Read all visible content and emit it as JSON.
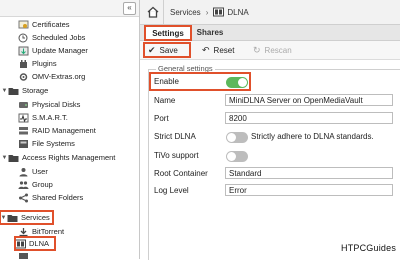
{
  "sidebar": {
    "collapse_glyph": "«",
    "items": [
      {
        "label": "Certificates",
        "icon": "certificate-icon"
      },
      {
        "label": "Scheduled Jobs",
        "icon": "clock-icon"
      },
      {
        "label": "Update Manager",
        "icon": "update-icon"
      },
      {
        "label": "Plugins",
        "icon": "plugin-icon"
      },
      {
        "label": "OMV-Extras.org",
        "icon": "extras-icon"
      },
      {
        "label": "Storage",
        "icon": "folder-icon",
        "expand": "▼"
      },
      {
        "label": "Physical Disks",
        "icon": "disk-icon"
      },
      {
        "label": "S.M.A.R.T.",
        "icon": "smart-icon"
      },
      {
        "label": "RAID Management",
        "icon": "raid-icon"
      },
      {
        "label": "File Systems",
        "icon": "filesystem-icon"
      },
      {
        "label": "Access Rights Management",
        "icon": "folder-icon",
        "expand": "▼"
      },
      {
        "label": "User",
        "icon": "user-icon"
      },
      {
        "label": "Group",
        "icon": "group-icon"
      },
      {
        "label": "Shared Folders",
        "icon": "share-icon"
      },
      {
        "label": "Services",
        "icon": "folder-icon",
        "expand": "▼"
      },
      {
        "label": "BitTorrent",
        "icon": "torrent-icon"
      },
      {
        "label": "DLNA",
        "icon": "dlna-icon"
      }
    ]
  },
  "header": {
    "home_icon": "home-icon",
    "crumb_services": "Services",
    "separator": "›",
    "crumb_dlna": "DLNA"
  },
  "tabs": [
    {
      "label": "Settings",
      "active": true
    },
    {
      "label": "Shares",
      "active": false
    }
  ],
  "toolbar": {
    "save_label": "Save",
    "reset_label": "Reset",
    "rescan_label": "Rescan"
  },
  "form": {
    "legend": "General settings",
    "enable_label": "Enable",
    "enable_value": true,
    "name_label": "Name",
    "name_value": "MiniDLNA Server on OpenMediaVault",
    "port_label": "Port",
    "port_value": "8200",
    "strict_label": "Strict DLNA",
    "strict_value": false,
    "strict_hint": "Strictly adhere to DLNA standards.",
    "tivo_label": "TiVo support",
    "tivo_value": false,
    "root_label": "Root Container",
    "root_value": "Standard",
    "log_label": "Log Level",
    "log_value": "Error"
  },
  "colors": {
    "highlight": "#e0502b",
    "toggle_on": "#5cb85c",
    "toggle_off": "#bdbdbd"
  },
  "watermark": "HTPCGuides"
}
